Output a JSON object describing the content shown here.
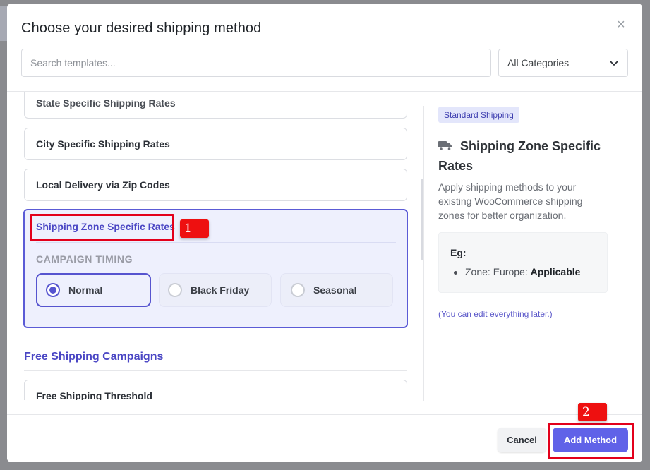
{
  "modal": {
    "title": "Choose your desired shipping method",
    "close_icon": "close-icon",
    "search_placeholder": "Search templates...",
    "category_select": "All Categories"
  },
  "list": {
    "partial_item": "State Specific Shipping Rates",
    "items": [
      "City Specific Shipping Rates",
      "Local Delivery via Zip Codes"
    ],
    "selected": {
      "title": "Shipping Zone Specific Rates",
      "timing_label": "CAMPAIGN TIMING",
      "options": [
        {
          "label": "Normal",
          "checked": true
        },
        {
          "label": "Black Friday",
          "checked": false
        },
        {
          "label": "Seasonal",
          "checked": false
        }
      ]
    },
    "section_heading": "Free Shipping Campaigns",
    "section_items": [
      "Free Shipping Threshold"
    ]
  },
  "detail": {
    "tag": "Standard Shipping",
    "icon": "truck-icon",
    "title": "Shipping Zone Specific Rates",
    "description": "Apply shipping methods to your existing WooCommerce shipping zones for better organization.",
    "example_label": "Eg:",
    "example_item_prefix": "Zone: Europe:",
    "example_item_value": "Applicable",
    "edit_note": "(You can edit everything later.)"
  },
  "footer": {
    "cancel_label": "Cancel",
    "add_label": "Add Method"
  },
  "annotations": {
    "badge_1": "1",
    "badge_2": "2"
  },
  "colors": {
    "accent": "#5b5bd6",
    "primary_button": "#6062e8",
    "annotation_red": "#e3001b"
  }
}
